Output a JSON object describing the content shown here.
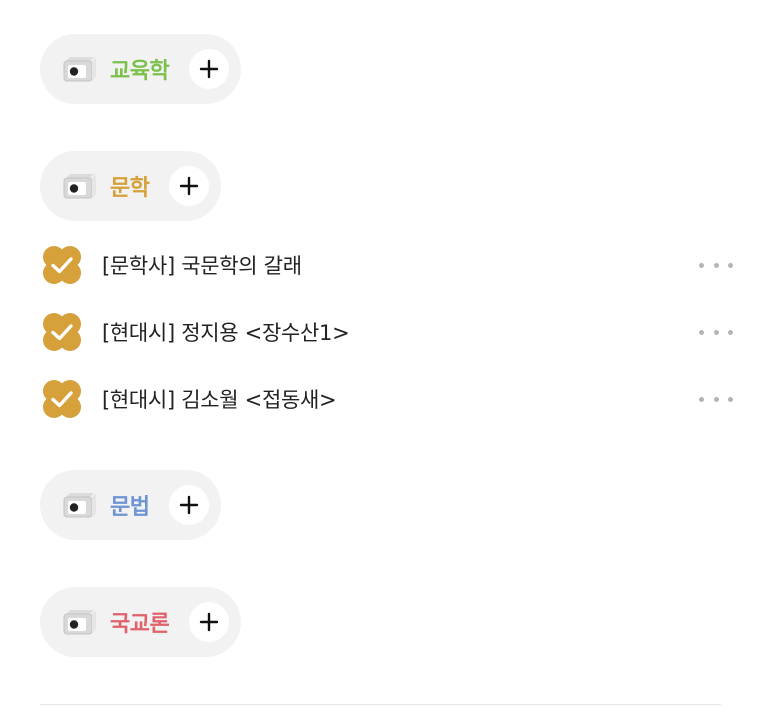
{
  "colors": {
    "education": "#7cc04b",
    "literature": "#d6a03a",
    "grammar": "#6f94d4",
    "korean_theory": "#e0636b",
    "check": "#d6a03a",
    "pill_bg": "#f2f2f2"
  },
  "icons": {
    "category": "folder-box-icon",
    "add": "plus-icon",
    "check": "checkmark-icon",
    "more": "more-dots-icon"
  },
  "categories": [
    {
      "label": "교육학"
    },
    {
      "label": "문학"
    },
    {
      "label": "문법"
    },
    {
      "label": "국교론"
    }
  ],
  "todos": [
    {
      "text": "[문학사] 국문학의 갈래",
      "done": true
    },
    {
      "text": "[현대시] 정지용 <장수산1>",
      "done": true
    },
    {
      "text": "[현대시] 김소월 <접동새>",
      "done": true
    }
  ]
}
